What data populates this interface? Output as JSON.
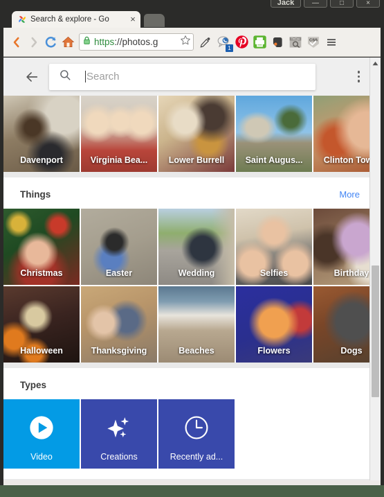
{
  "window": {
    "username": "Jack",
    "minimize_label": "—",
    "maximize_label": "□",
    "close_label": "×"
  },
  "browser": {
    "tab": {
      "title": "Search & explore - Go",
      "favicon": "google-photos-pinwheel-icon",
      "close_label": "×"
    },
    "new_tab_label": "",
    "nav": {
      "back": "back-arrow-icon",
      "forward": "forward-arrow-icon",
      "reload": "reload-icon",
      "home": "home-icon"
    },
    "url": {
      "scheme": "https",
      "rest": "://photos.g",
      "lock": "padlock-icon",
      "star": "bookmark-star-icon"
    },
    "extensions": [
      {
        "name": "eyedropper-icon",
        "badge": ""
      },
      {
        "name": "chat-bubble-icon",
        "badge": "1"
      },
      {
        "name": "pinterest-icon",
        "badge": ""
      },
      {
        "name": "printer-icon",
        "badge": ""
      },
      {
        "name": "evernote-icon",
        "badge": ""
      },
      {
        "name": "tineye-icon",
        "badge": ""
      },
      {
        "name": "css-validator-icon",
        "badge": ""
      }
    ],
    "menu_label": "hamburger-menu-icon"
  },
  "app": {
    "back_label": "back-arrow-icon",
    "search": {
      "placeholder": "Search",
      "value": "",
      "icon": "search-icon"
    },
    "overflow_label": "three-dot-menu-icon"
  },
  "sections": [
    {
      "id": "places",
      "title": "",
      "more_label": "",
      "rows": [
        [
          {
            "label": "Davenport",
            "thumb": "boy-eating-cupcake"
          },
          {
            "label": "Virginia Bea...",
            "thumb": "three-women-crab-shirts"
          },
          {
            "label": "Lower Burrell",
            "thumb": "woman-holding-baby-hat"
          },
          {
            "label": "Saint Augus...",
            "thumb": "stone-fort-palm-trees"
          },
          {
            "label": "Clinton Tow...",
            "thumb": "children-outdoors"
          }
        ]
      ]
    },
    {
      "id": "things",
      "title": "Things",
      "more_label": "More",
      "rows": [
        [
          {
            "label": "Christmas",
            "thumb": "child-christmas-tree"
          },
          {
            "label": "Easter",
            "thumb": "child-easter-basket"
          },
          {
            "label": "Wedding",
            "thumb": "van-on-street"
          },
          {
            "label": "Selfies",
            "thumb": "man-with-two-children"
          },
          {
            "label": "Birthday",
            "thumb": "purple-balloons"
          }
        ],
        [
          {
            "label": "Halloween",
            "thumb": "child-costume-pumpkins"
          },
          {
            "label": "Thanksgiving",
            "thumb": "couple-in-kitchen"
          },
          {
            "label": "Beaches",
            "thumb": "ocean-waves-sand"
          },
          {
            "label": "Flowers",
            "thumb": "orange-flower-blue-bg"
          },
          {
            "label": "Dogs",
            "thumb": "pug-dog-floor"
          }
        ]
      ]
    }
  ],
  "types": {
    "title": "Types",
    "items": [
      {
        "label": "Video",
        "icon": "play-circle-icon",
        "color": "#039BE5"
      },
      {
        "label": "Creations",
        "icon": "sparkles-icon",
        "color": "#3949AB"
      },
      {
        "label": "Recently ad...",
        "icon": "clock-icon",
        "color": "#3949AB"
      }
    ]
  },
  "scrollbar": {
    "up_arrow": "scroll-up-arrow-icon",
    "thumb": "scroll-thumb"
  }
}
